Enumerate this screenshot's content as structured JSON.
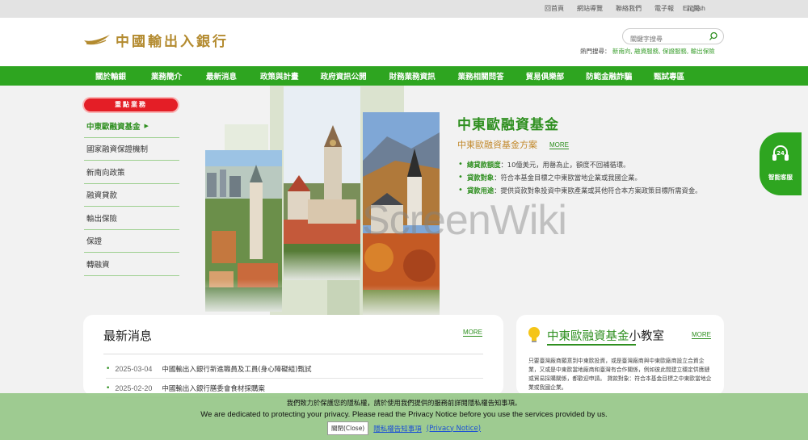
{
  "topbar": {
    "links": [
      "回首頁",
      "網站導覽",
      "聯絡我們",
      "電子報",
      "訂閱"
    ],
    "language": "English"
  },
  "header": {
    "logo_text": "中國輸出入銀行",
    "search_placeholder": "關鍵字搜尋",
    "hot_search_label": "熱門搜尋：",
    "hot_search_items": "新南向, 融資服務, 保證服務, 輸出保險"
  },
  "nav": {
    "items": [
      "關於輸銀",
      "業務簡介",
      "最新消息",
      "政策與計畫",
      "政府資訊公開",
      "財務業務資訊",
      "業務相關問答",
      "貿易俱樂部",
      "防範金融詐騙",
      "甄試專區"
    ]
  },
  "sidebar": {
    "badge": "重點業務",
    "items": [
      "中東歐融資基金",
      "國家融資保證機制",
      "新南向政策",
      "融資貸款",
      "輸出保險",
      "保證",
      "轉融資"
    ]
  },
  "hero": {
    "title": "中東歐融資基金",
    "subtitle": "中東歐融資基金方案",
    "more": "MORE",
    "bullets": [
      {
        "key": "總貸款額度",
        "text": "：10億美元，用罄為止，額度不回補循環。"
      },
      {
        "key": "貸款對象",
        "text": "：符合本基金目標之中東歐當地企業或我國企業。"
      },
      {
        "key": "貸款用途",
        "text": "：提供貸款對象投資中東歐產業或其他符合本方案政策目標所需資金。"
      }
    ]
  },
  "watermark": "ScreenWiki",
  "float_service": {
    "label": "智能客服",
    "icon": "headset-24-icon"
  },
  "news": {
    "title": "最新消息",
    "more": "MORE",
    "items": [
      {
        "date": "2025-03-04",
        "text": "中國輸出入銀行新進職員及工員(身心障礙組)甄試"
      },
      {
        "date": "2025-02-20",
        "text": "中國輸出入銀行膳委會食材採購案"
      }
    ]
  },
  "classroom": {
    "title_green": "中東歐融資基金",
    "title_rest": "小教室",
    "more": "MORE",
    "desc": "只要臺灣廠商願意到中東歐投資，或是臺灣廠商與中東歐廠商設立合資企業，又或是中東歐當地廠商和臺灣有合作關係，例如彼此間建立穩定供應鏈或貿易採購關係，都歡迎申請。 貸款對象：符合本基金目標之中東歐當地企業或我國企業。"
  },
  "privacy": {
    "zh": "我們致力於保護您的隱私權，請於使用我們提供的服務前詳閱隱私權告知事項。",
    "en": "We are dedicated to protecting your privacy. Please read the Privacy Notice before you use the services provided by us.",
    "close": "關閉(Close)",
    "link_zh": "隱私權告知事項",
    "link_en": "(Privacy Notice)"
  },
  "colors": {
    "brand_green": "#2ea520",
    "accent_gold": "#c2892c",
    "badge_red": "#e41e26"
  }
}
